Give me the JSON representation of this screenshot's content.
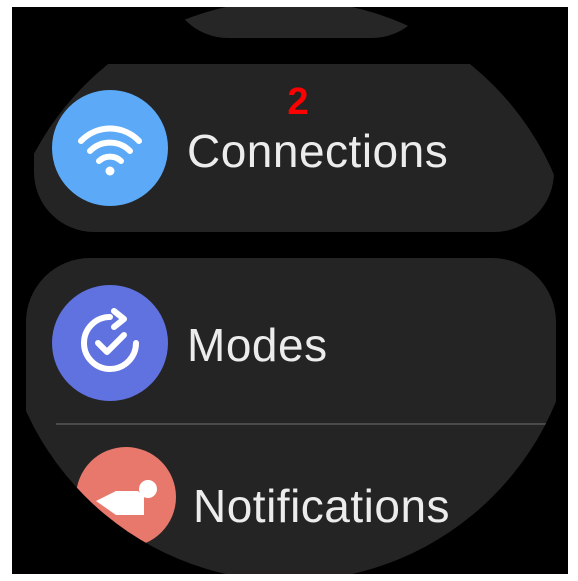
{
  "menu": {
    "items": [
      {
        "label": "Connections",
        "icon": "wifi-icon",
        "color": "#5ba9f7"
      },
      {
        "label": "Modes",
        "icon": "modes-check-icon",
        "color": "#5f72df"
      },
      {
        "label": "Notifications",
        "icon": "notifications-icon",
        "color": "#e8776c"
      }
    ]
  },
  "annotation": {
    "marker": "2",
    "color": "#ff0000"
  }
}
